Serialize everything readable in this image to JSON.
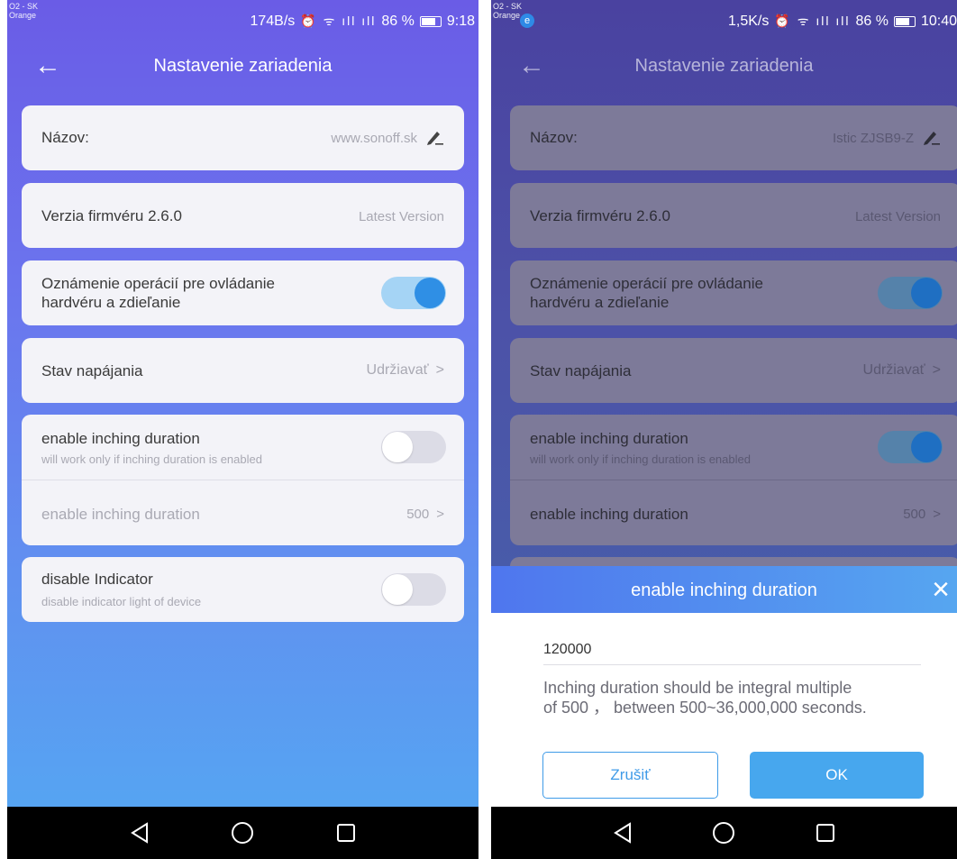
{
  "left": {
    "status": {
      "carrier_line1": "O2 - SK",
      "carrier_line2": "Orange",
      "speed": "174B/s",
      "battery_pct": "86 %",
      "time": "9:18"
    },
    "header": {
      "title": "Nastavenie zariadenia"
    },
    "name_row": {
      "label": "Názov:",
      "value": "www.sonoff.sk"
    },
    "firmware_row": {
      "label": "Verzia firmvéru 2.6.0",
      "value": "Latest Version"
    },
    "notify_row": {
      "label_line1": "Oznámenie operácií pre ovládanie",
      "label_line2": "hardvéru a zdieľanie",
      "enabled": true
    },
    "power_row": {
      "label": "Stav napájania",
      "value": "Udržiavať"
    },
    "inching_row": {
      "label": " enable inching  duration",
      "sublabel": "will work only if inching duration is enabled",
      "enabled": false
    },
    "inching_value_row": {
      "label": "enable inching  duration",
      "value": "500"
    },
    "indicator_row": {
      "label": "disable Indicator",
      "sublabel": "disable indicator light of device",
      "enabled": false
    }
  },
  "right": {
    "status": {
      "carrier_line1": "O2 - SK",
      "carrier_line2": "Orange",
      "badge": "e",
      "speed": "1,5K/s",
      "battery_pct": "86 %",
      "time": "10:40"
    },
    "header": {
      "title": "Nastavenie zariadenia"
    },
    "name_row": {
      "label": "Názov:",
      "value": "Istic ZJSB9-Z"
    },
    "firmware_row": {
      "label": "Verzia firmvéru 2.6.0",
      "value": "Latest Version"
    },
    "notify_row": {
      "label_line1": "Oznámenie operácií pre ovládanie",
      "label_line2": "hardvéru a zdieľanie",
      "enabled": true
    },
    "power_row": {
      "label": "Stav napájania",
      "value": "Udržiavať"
    },
    "inching_row": {
      "label": " enable inching  duration",
      "sublabel": "will work only if inching duration is enabled",
      "enabled": true
    },
    "inching_value_row": {
      "label": "enable inching  duration",
      "value": "500"
    },
    "dialog": {
      "title": "enable inching  duration",
      "input_value": "120000",
      "hint_line1": "Inching  duration should be integral multiple",
      "hint_line2": "of  500 ，  between 500~36,000,000 seconds.",
      "cancel_label": "Zrušiť",
      "ok_label": "OK"
    }
  },
  "colors": {
    "accent": "#2f8fe5",
    "gradient_top": "#6a5ce6",
    "gradient_bottom": "#56a4f2",
    "card_bg": "#f3f3f8"
  },
  "icons": {
    "back": "arrow-left-icon",
    "edit": "edit-pen-icon",
    "chevron": "chevron-right-icon",
    "close": "close-icon",
    "nav_back": "triangle-back-icon",
    "nav_home": "circle-home-icon",
    "nav_recent": "square-recent-icon"
  }
}
